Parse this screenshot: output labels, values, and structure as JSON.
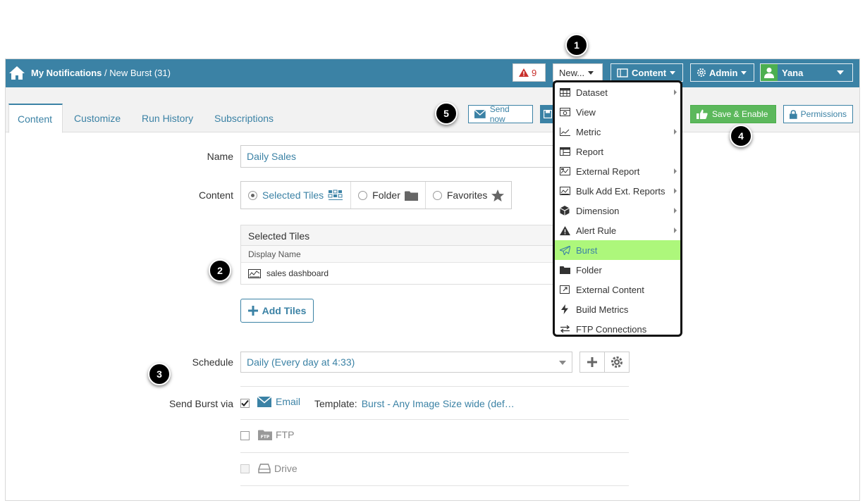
{
  "header": {
    "crumb_root": "My Notifications",
    "crumb_current": " / New Burst (31)",
    "alert_count": "9",
    "new_label": "New...",
    "content_label": "Content",
    "admin_label": "Admin",
    "user_name": "Yana"
  },
  "tabs": [
    {
      "label": "Content"
    },
    {
      "label": "Customize"
    },
    {
      "label": "Run History"
    },
    {
      "label": "Subscriptions"
    }
  ],
  "actions": {
    "send_now": "Send now",
    "save_enable": "Save & Enable",
    "permissions": "Permissions"
  },
  "form": {
    "name_label": "Name",
    "name_value": "Daily Sales",
    "content_label": "Content",
    "content_options": [
      "Selected Tiles",
      "Folder",
      "Favorites"
    ],
    "tiles_header": "Selected Tiles",
    "tiles_column": "Display Name",
    "tiles_row": "sales dashboard",
    "add_tiles": "Add Tiles",
    "schedule_label": "Schedule",
    "schedule_value": "Daily (Every day at 4:33)",
    "send_via_label": "Send Burst via",
    "email_label": "Email",
    "template_label": "Template:",
    "template_value": "Burst - Any Image Size wide (def…",
    "ftp_label": "FTP",
    "drive_label": "Drive"
  },
  "menu": [
    {
      "label": "Dataset"
    },
    {
      "label": "View"
    },
    {
      "label": "Metric"
    },
    {
      "label": "Report"
    },
    {
      "label": "External Report"
    },
    {
      "label": "Bulk Add Ext. Reports"
    },
    {
      "label": "Dimension"
    },
    {
      "label": "Alert Rule"
    },
    {
      "label": "Burst"
    },
    {
      "label": "Folder"
    },
    {
      "label": "External Content"
    },
    {
      "label": "Build Metrics"
    },
    {
      "label": "FTP Connections"
    }
  ],
  "badges": [
    "1",
    "2",
    "3",
    "4",
    "5"
  ],
  "colors": {
    "header": "#3b82a5",
    "highlight": "#adf77b",
    "success": "#5cb85c",
    "alert": "#c9302c"
  }
}
